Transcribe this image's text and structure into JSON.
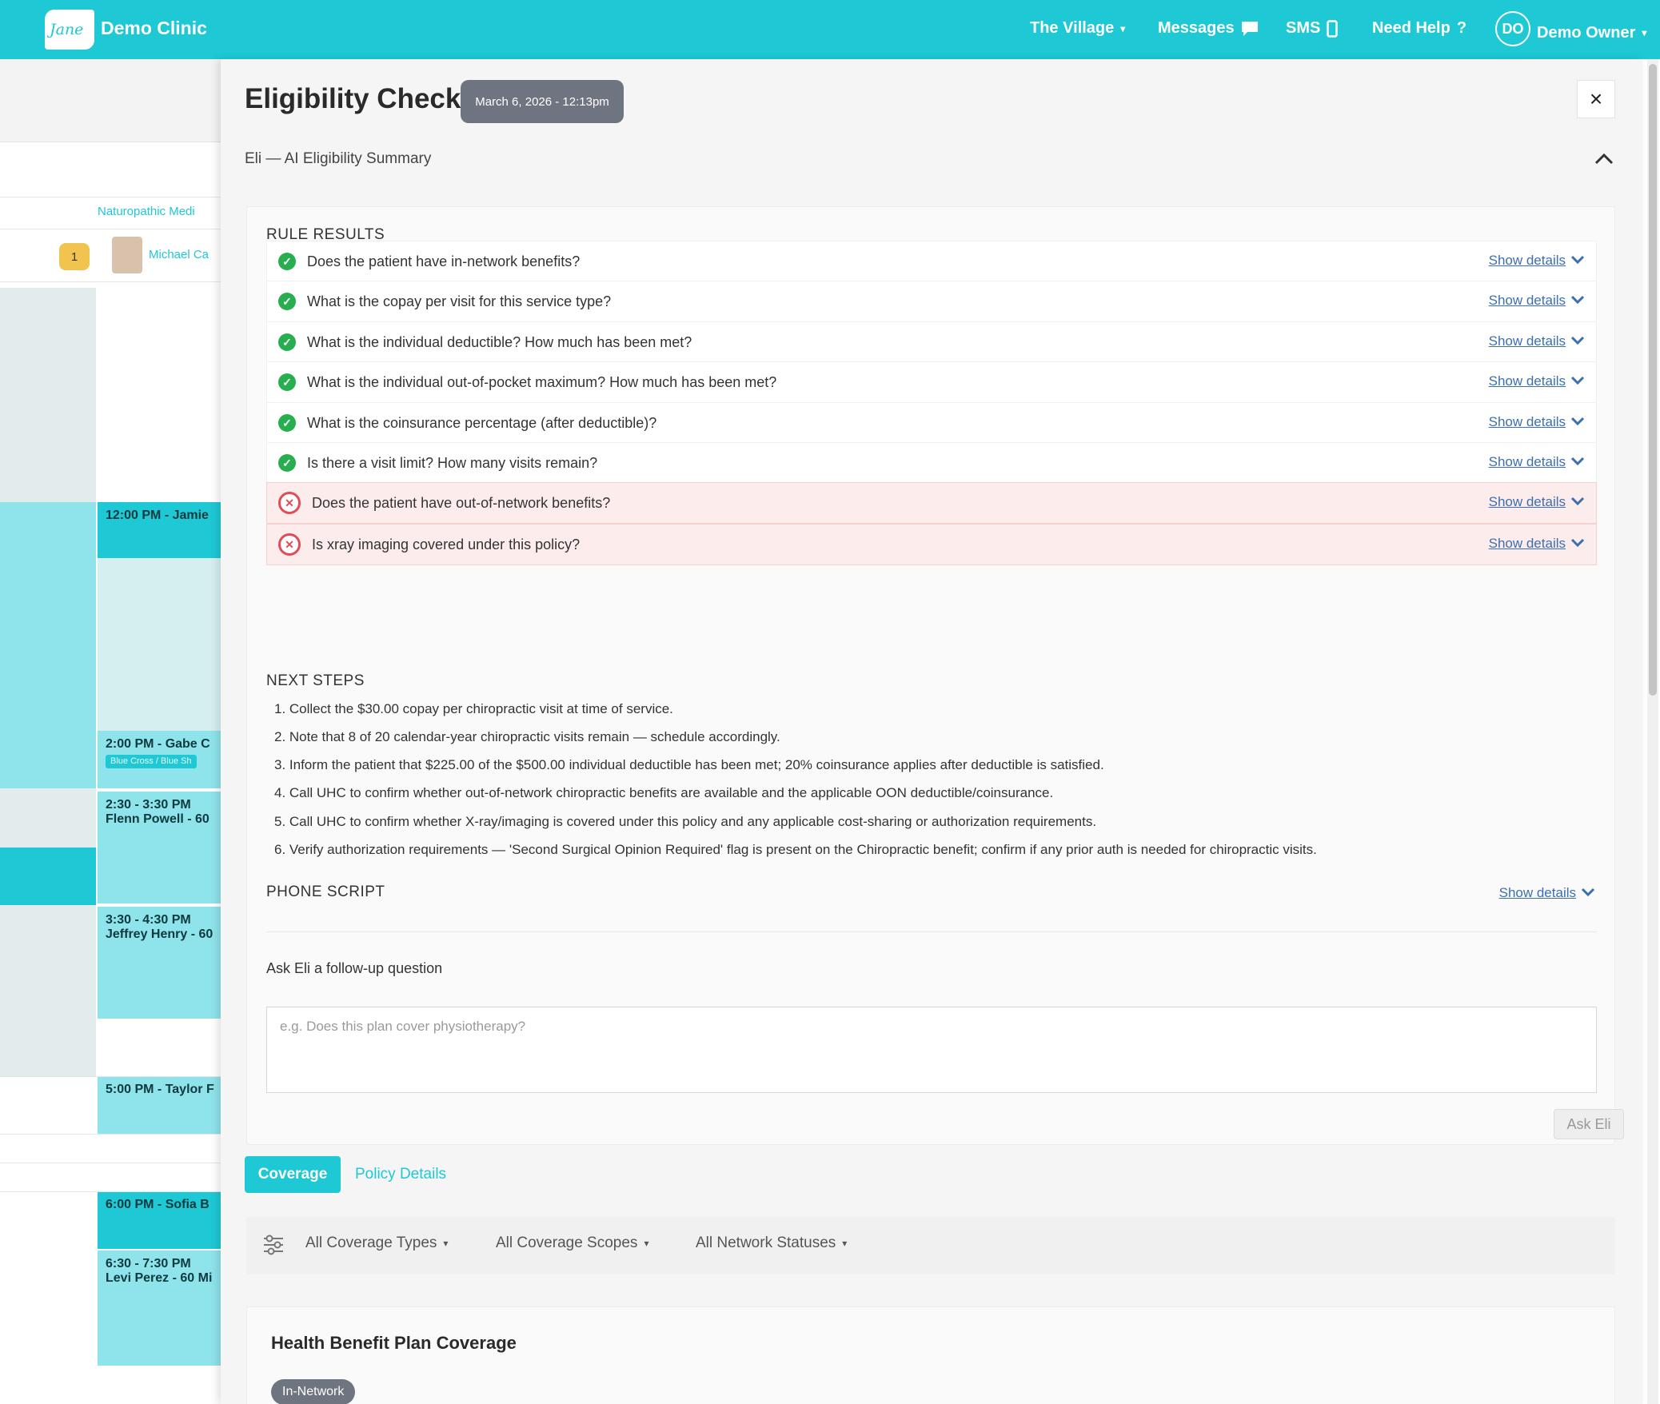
{
  "topbar": {
    "logo_text": "Jane",
    "clinic_name": "Demo Clinic",
    "nav": {
      "village": "The Village",
      "messages": "Messages",
      "sms": "SMS",
      "help": "Need Help",
      "user_initials": "DO",
      "user_name": "Demo Owner"
    }
  },
  "calendar": {
    "column_header": "Naturopathic Medi",
    "badge_count": "1",
    "practitioner": "Michael Ca",
    "appointments": [
      {
        "time": "12:00 PM - Jamie",
        "detail": ""
      },
      {
        "time": "2:00 PM - Gabe C",
        "detail": "Blue Cross / Blue Sh"
      },
      {
        "time": "2:30 - 3:30 PM",
        "detail": "Flenn Powell - 60"
      },
      {
        "time": "3:30 - 4:30 PM",
        "detail": "Jeffrey Henry - 60"
      },
      {
        "time": "5:00 PM - Taylor F",
        "detail": ""
      },
      {
        "time": "6:00 PM - Sofia B",
        "detail": ""
      },
      {
        "time": "6:30 - 7:30 PM",
        "detail": "Levi Perez - 60 Mi"
      }
    ]
  },
  "modal": {
    "title": "Eligibility Check",
    "date": "March 6, 2026 - 12:13pm",
    "close_label": "×",
    "eli_header": "Eli — AI Eligibility Summary",
    "rule_results_label": "RULE RESULTS",
    "show_details_label": "Show details",
    "rules": [
      {
        "text": "Does the patient have in-network benefits?",
        "status": "pass"
      },
      {
        "text": "What is the copay per visit for this service type?",
        "status": "pass"
      },
      {
        "text": "What is the individual deductible? How much has been met?",
        "status": "pass"
      },
      {
        "text": "What is the individual out-of-pocket maximum? How much has been met?",
        "status": "pass"
      },
      {
        "text": "What is the coinsurance percentage (after deductible)?",
        "status": "pass"
      },
      {
        "text": "Is there a visit limit? How many visits remain?",
        "status": "pass"
      },
      {
        "text": "Does the patient have out-of-network benefits?",
        "status": "fail"
      },
      {
        "text": "Is xray imaging covered under this policy?",
        "status": "fail"
      }
    ],
    "next_steps_label": "NEXT STEPS",
    "next_steps": [
      "1. Collect the $30.00 copay per chiropractic visit at time of service.",
      "2. Note that 8 of 20 calendar-year chiropractic visits remain — schedule accordingly.",
      "3. Inform the patient that $225.00 of the $500.00 individual deductible has been met; 20% coinsurance applies after deductible is satisfied.",
      "4. Call UHC to confirm whether out-of-network chiropractic benefits are available and the applicable OON deductible/coinsurance.",
      "5. Call UHC to confirm whether X-ray/imaging is covered under this policy and any applicable cost-sharing or authorization requirements.",
      "6. Verify authorization requirements — 'Second Surgical Opinion Required' flag is present on the Chiropractic benefit; confirm if any prior auth is needed for chiropractic visits."
    ],
    "phone_script_label": "PHONE SCRIPT",
    "followup_label": "Ask Eli a follow-up question",
    "followup_placeholder": "e.g. Does this plan cover physiotherapy?",
    "ask_button": "Ask Eli",
    "tabs": {
      "coverage": "Coverage",
      "policy": "Policy Details"
    },
    "filters": {
      "types": "All Coverage Types",
      "scopes": "All Coverage Scopes",
      "network": "All Network Statuses"
    },
    "plan_card": {
      "title": "Health Benefit Plan Coverage",
      "network_pill": "In-Network"
    }
  },
  "colors": {
    "brand": "#1ec8d5",
    "pass": "#27ae4f",
    "fail": "#e04d55",
    "link": "#3b6fb0"
  }
}
